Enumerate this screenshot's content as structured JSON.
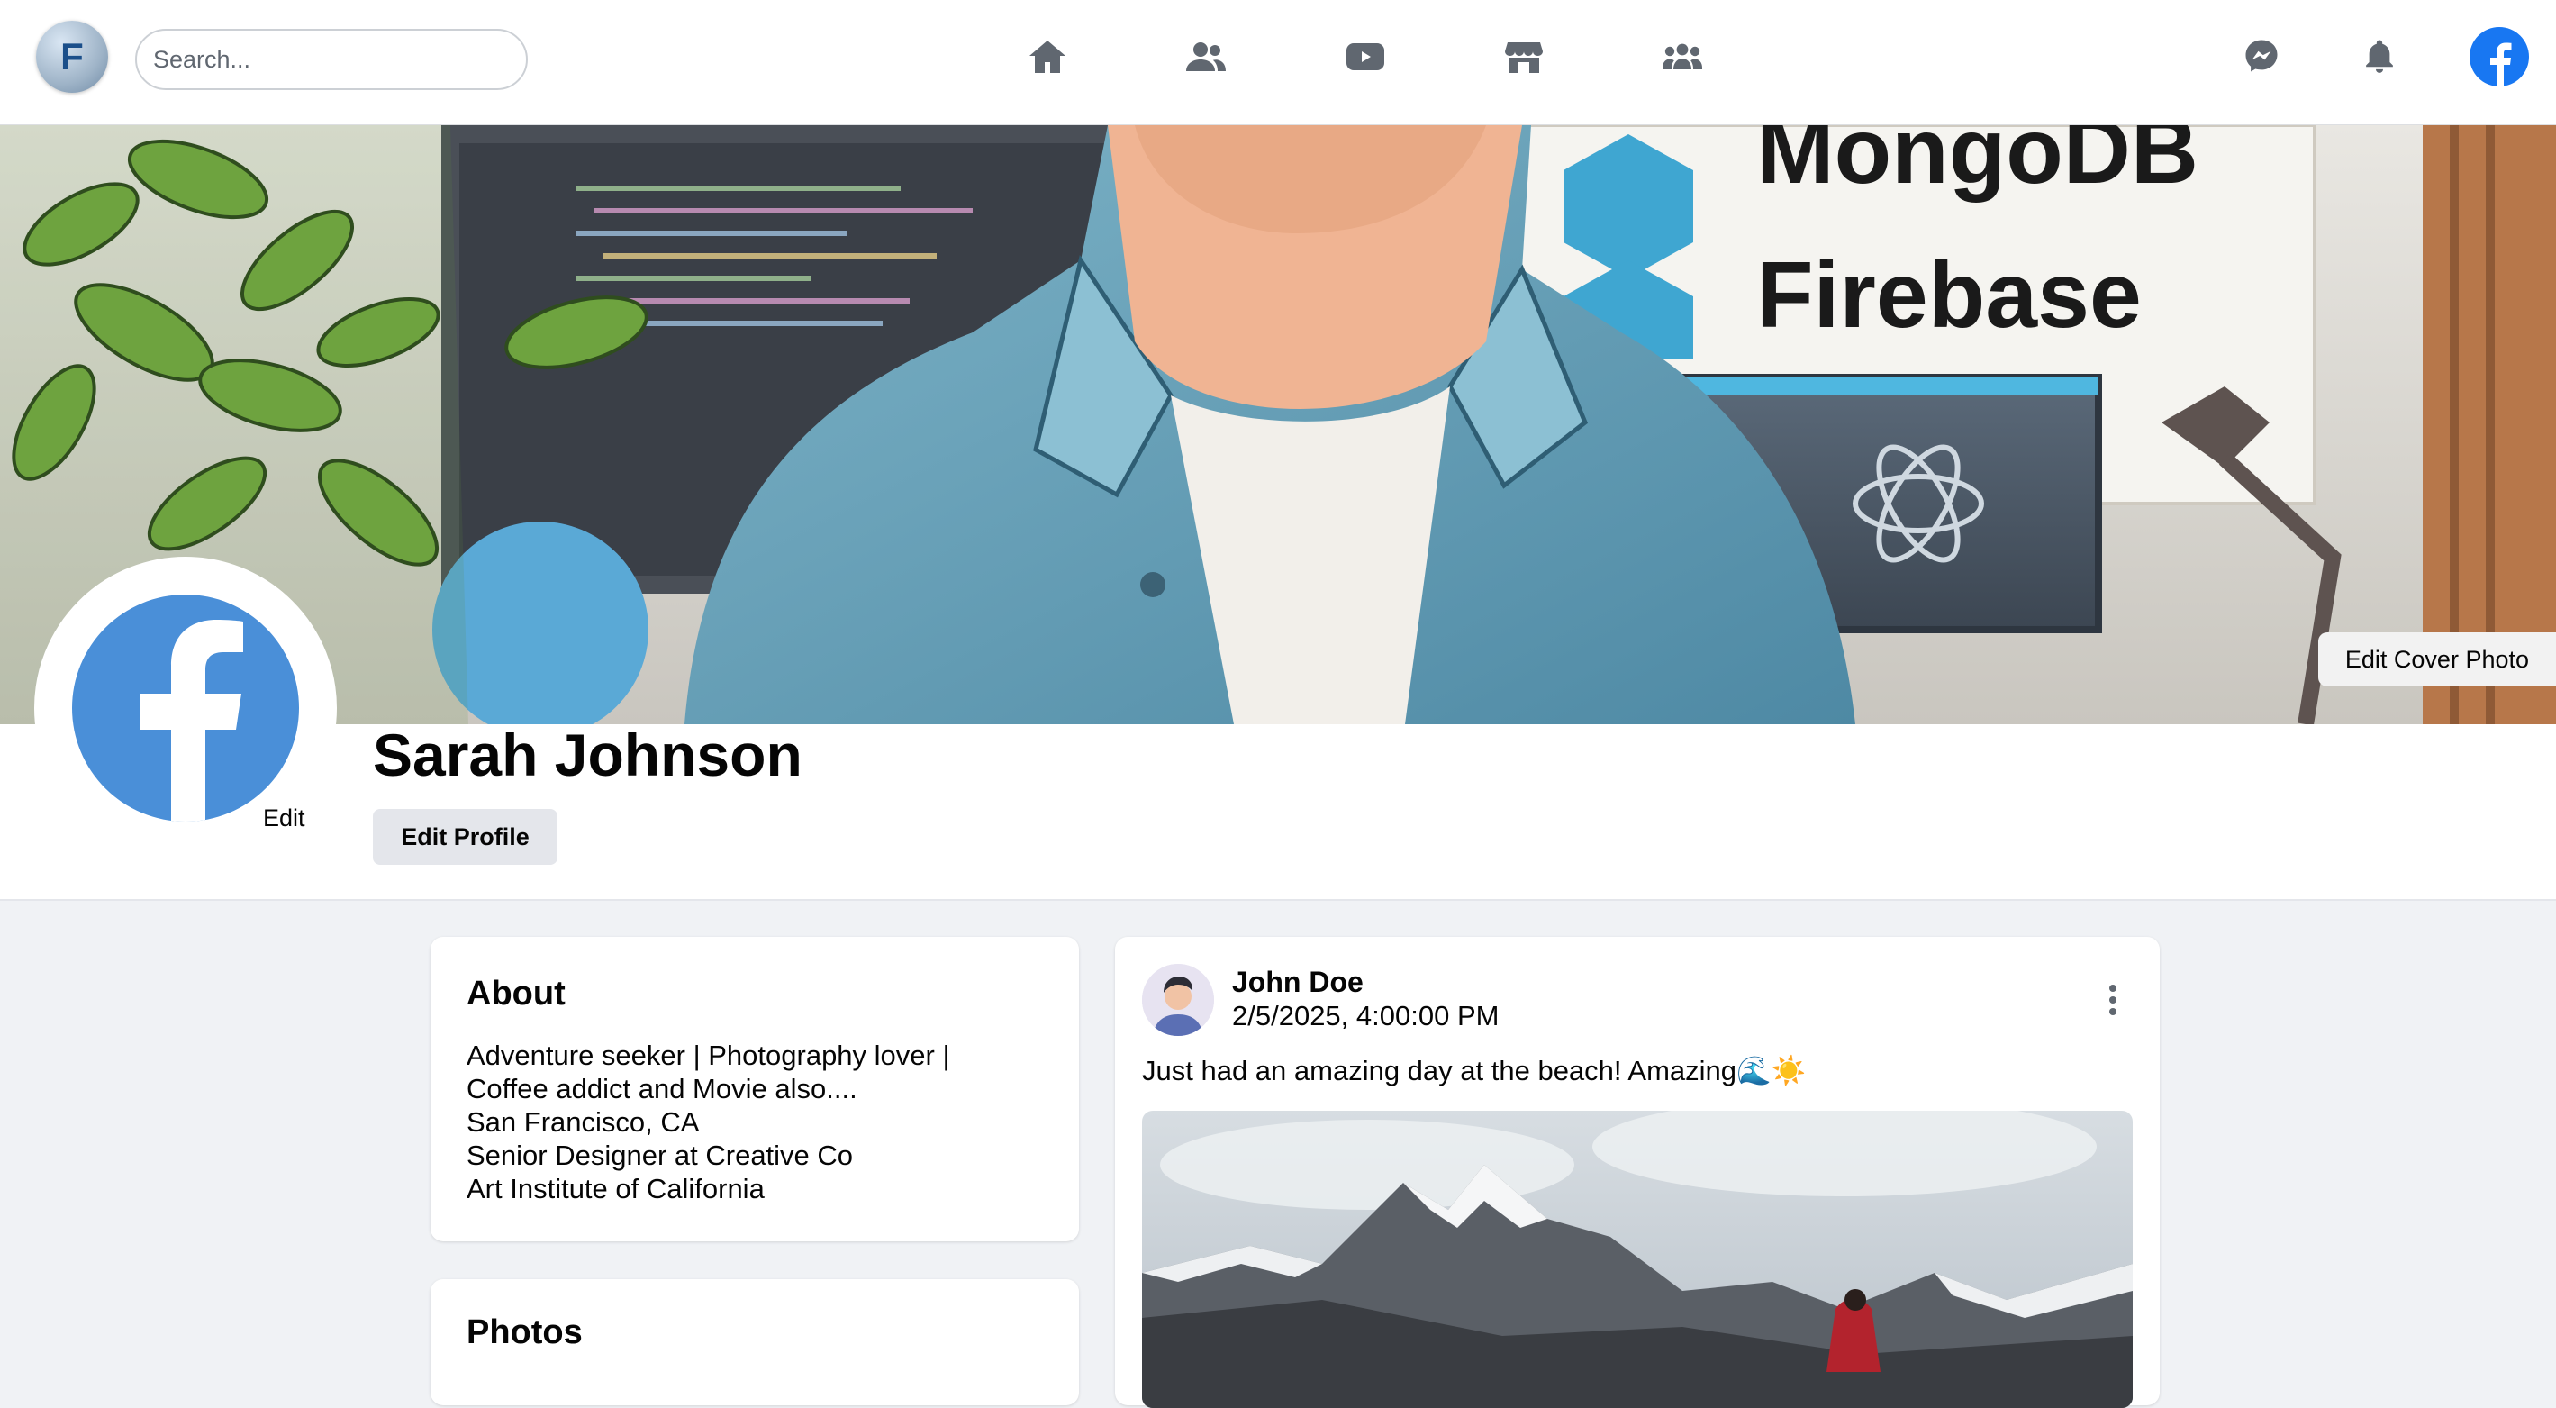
{
  "nav": {
    "logo_letter": "F",
    "search_placeholder": "Search...",
    "icons": [
      "home-icon",
      "friends-icon",
      "watch-icon",
      "marketplace-icon",
      "groups-icon"
    ],
    "right_icons": [
      "messenger-icon",
      "bell-icon",
      "facebook-icon"
    ],
    "icon_color": "#606770",
    "brand_color": "#1877f2"
  },
  "cover": {
    "text_top": "MongoDB",
    "text_bottom": "Firebase",
    "edit_label": "Edit Cover Photo"
  },
  "profile": {
    "name": "Sarah Johnson",
    "avatar_edit_label": "Edit",
    "edit_profile_label": "Edit Profile"
  },
  "about": {
    "title": "About",
    "bio_line1": "Adventure seeker | Photography lover |",
    "bio_line2": "Coffee addict and Movie also....",
    "location": "San Francisco, CA",
    "work": "Senior Designer at Creative Co",
    "education": "Art Institute of California"
  },
  "photos": {
    "title": "Photos"
  },
  "post": {
    "author": "John Doe",
    "time": "2/5/2025, 4:00:00 PM",
    "text": "Just had an amazing day at the beach! Amazing🌊☀️"
  }
}
